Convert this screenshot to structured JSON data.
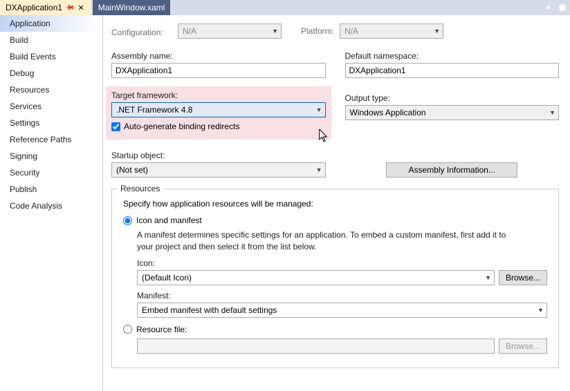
{
  "tabs": {
    "active": "DXApplication1",
    "inactive": "MainWindow.xaml"
  },
  "sidebar": {
    "items": [
      "Application",
      "Build",
      "Build Events",
      "Debug",
      "Resources",
      "Services",
      "Settings",
      "Reference Paths",
      "Signing",
      "Security",
      "Publish",
      "Code Analysis"
    ]
  },
  "toprow": {
    "config_label": "Configuration:",
    "config_value": "N/A",
    "platform_label": "Platform:",
    "platform_value": "N/A"
  },
  "assembly": {
    "name_label": "Assembly name:",
    "name_value": "DXApplication1",
    "ns_label": "Default namespace:",
    "ns_value": "DXApplication1"
  },
  "framework": {
    "label": "Target framework:",
    "value": ".NET Framework 4.8",
    "output_label": "Output type:",
    "output_value": "Windows Application",
    "auto_redirects": "Auto-generate binding redirects"
  },
  "startup": {
    "label": "Startup object:",
    "value": "(Not set)",
    "asm_info_btn": "Assembly Information..."
  },
  "resources": {
    "group_title": "Resources",
    "desc": "Specify how application resources will be managed:",
    "icon_manifest": "Icon and manifest",
    "manifest_desc": "A manifest determines specific settings for an application. To embed a custom manifest, first add it to your project and then select it from the list below.",
    "icon_label": "Icon:",
    "icon_value": "(Default Icon)",
    "browse": "Browse...",
    "manifest_label": "Manifest:",
    "manifest_value": "Embed manifest with default settings",
    "resource_file": "Resource file:"
  }
}
